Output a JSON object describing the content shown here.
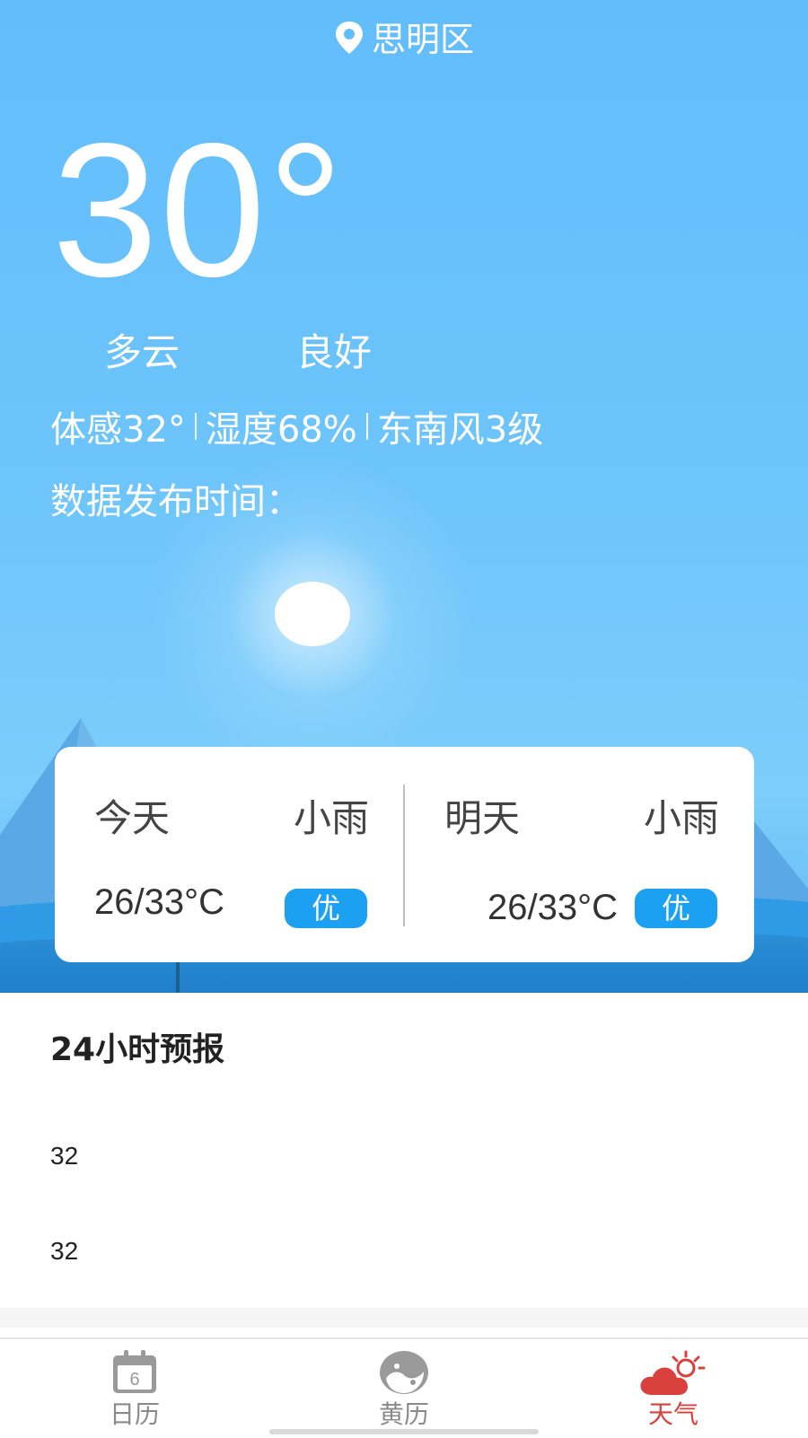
{
  "header": {
    "location": "思明区",
    "location_icon": "location-pin-icon"
  },
  "current": {
    "temperature": "30°",
    "weather": "多云",
    "air_quality": "良好",
    "feels_like": "体感32°",
    "humidity": "湿度68%",
    "wind": "东南风3级",
    "published_label": "数据发布时间："
  },
  "forecast_card": {
    "today": {
      "label": "今天",
      "weather": "小雨",
      "range": "26/33°C",
      "aqi": "优"
    },
    "tomorrow": {
      "label": "明天",
      "weather": "小雨",
      "range": "26/33°C",
      "aqi": "优"
    }
  },
  "hourly": {
    "title": "24小时预报",
    "values": [
      "32",
      "32"
    ]
  },
  "tabbar": {
    "items": [
      {
        "label": "日历",
        "icon": "calendar-icon",
        "icon_text": "6",
        "active": false
      },
      {
        "label": "黄历",
        "icon": "yin-yang-icon",
        "active": false
      },
      {
        "label": "天气",
        "icon": "weather-cloud-sun-icon",
        "active": true
      }
    ]
  },
  "colors": {
    "sky": "#62bdfb",
    "aqi_badge": "#1ca0f1",
    "active_tab": "#d9403e",
    "inactive_tab": "#8a8a8a"
  }
}
